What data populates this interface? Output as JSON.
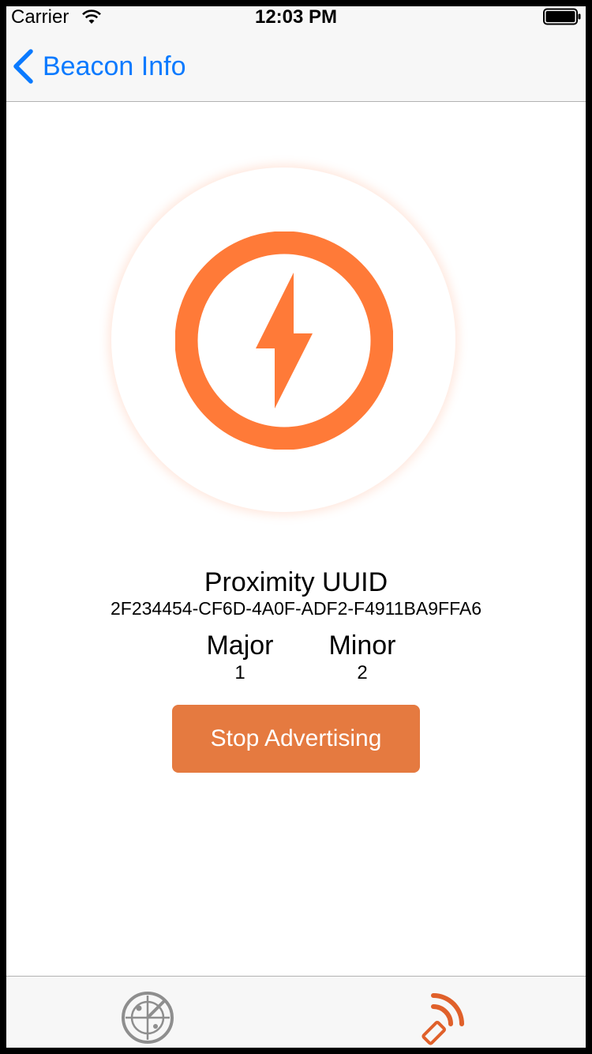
{
  "status_bar": {
    "carrier": "Carrier",
    "time": "12:03 PM"
  },
  "nav": {
    "back_label": "Beacon Info"
  },
  "beacon": {
    "proximity_uuid_label": "Proximity UUID",
    "proximity_uuid": "2F234454-CF6D-4A0F-ADF2-F4911BA9FFA6",
    "major_label": "Major",
    "major_value": "1",
    "minor_label": "Minor",
    "minor_value": "2"
  },
  "actions": {
    "stop_label": "Stop Advertising"
  },
  "tabs": [
    {
      "icon": "radar-icon",
      "selected": false
    },
    {
      "icon": "broadcast-icon",
      "selected": true
    }
  ],
  "colors": {
    "accent": "#0a7aff",
    "beacon_orange": "#ff7a38",
    "button_orange": "#e57a40",
    "tab_inactive": "#8e8e8e",
    "tab_active": "#e0602a"
  }
}
